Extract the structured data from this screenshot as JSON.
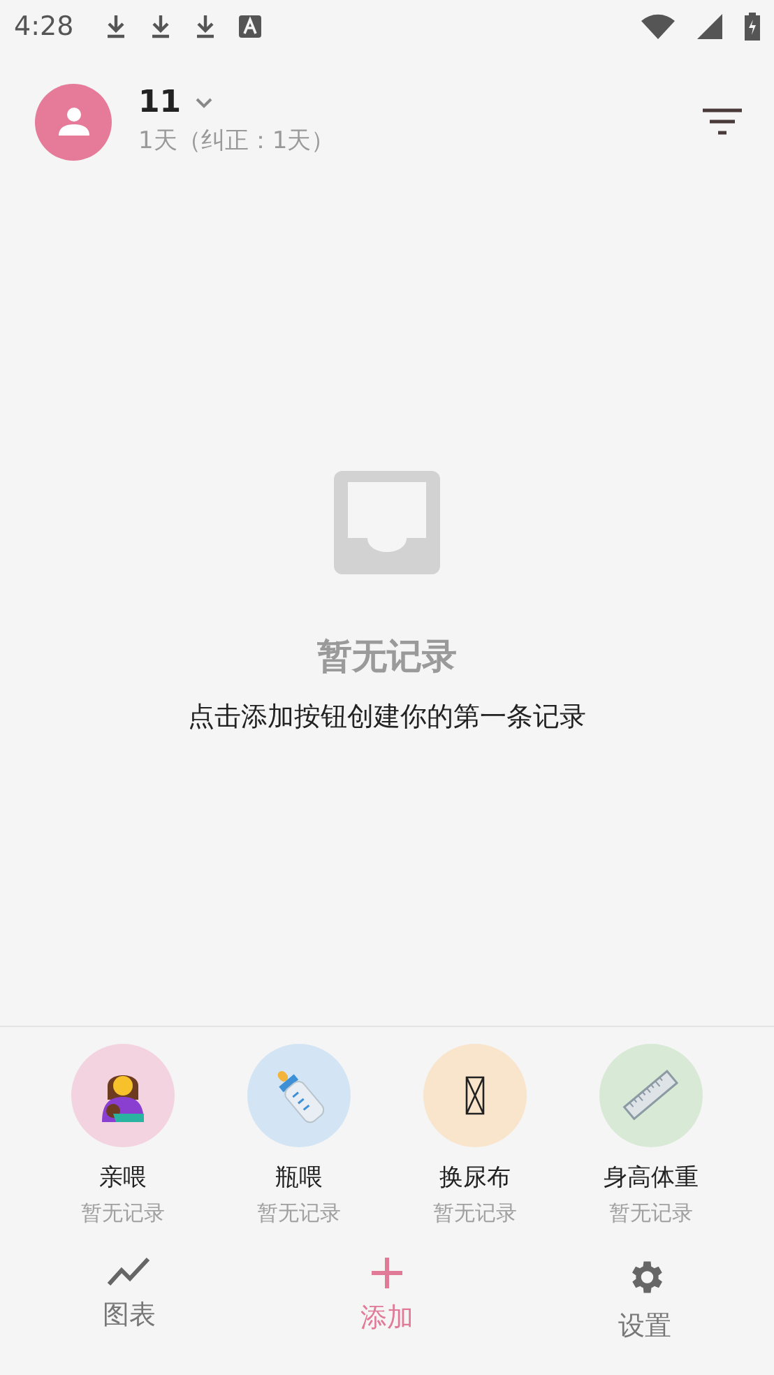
{
  "status_bar": {
    "time": "4:28"
  },
  "header": {
    "name": "11",
    "subtitle": "1天（纠正：1天）"
  },
  "empty_state": {
    "title": "暂无记录",
    "message": "点击添加按钮创建你的第一条记录"
  },
  "actions": [
    {
      "kind": "breastfeed",
      "label": "亲喂",
      "status": "暂无记录",
      "color": "#f3d3df"
    },
    {
      "kind": "bottle",
      "label": "瓶喂",
      "status": "暂无记录",
      "color": "#d3e5f5"
    },
    {
      "kind": "diaper",
      "label": "换尿布",
      "status": "暂无记录",
      "color": "#f8e5cc"
    },
    {
      "kind": "growth",
      "label": "身高体重",
      "status": "暂无记录",
      "color": "#d8ead6"
    }
  ],
  "nav": [
    {
      "kind": "chart",
      "label": "图表",
      "selected": false
    },
    {
      "kind": "add",
      "label": "添加",
      "selected": true
    },
    {
      "kind": "settings",
      "label": "设置",
      "selected": false
    }
  ]
}
